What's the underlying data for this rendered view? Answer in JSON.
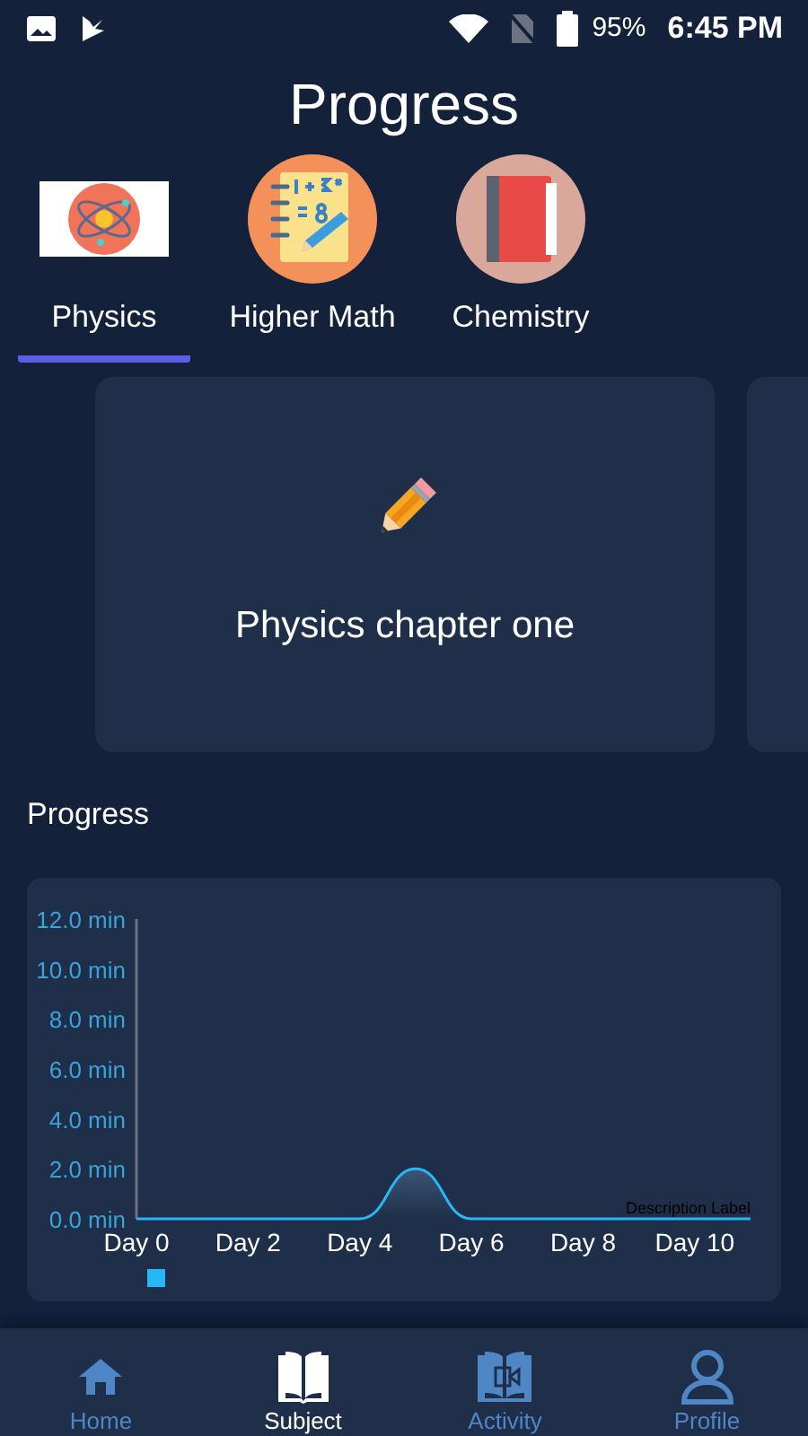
{
  "status_bar": {
    "battery": "95%",
    "time": "6:45 PM"
  },
  "title": "Progress",
  "tabs": [
    {
      "label": "Physics",
      "selected": true,
      "kind": "atom"
    },
    {
      "label": "Higher Math",
      "selected": false,
      "kind": "notebook"
    },
    {
      "label": "Chemistry",
      "selected": false,
      "kind": "book"
    }
  ],
  "cards": [
    {
      "title": "Physics chapter one"
    }
  ],
  "section_label": "Progress",
  "chart_data": {
    "type": "line",
    "categories": [
      "Day 0",
      null,
      "Day 2",
      null,
      "Day 4",
      null,
      "Day 6",
      null,
      "Day 8",
      null,
      "Day 10",
      null
    ],
    "series": [
      {
        "color": "#29b6f6",
        "values": [
          0,
          0,
          0,
          0,
          0,
          2,
          0,
          0,
          0,
          0,
          0,
          0
        ]
      }
    ],
    "ylim": [
      0,
      12
    ],
    "yticks": [
      {
        "value": 0,
        "label": "0.0 min"
      },
      {
        "value": 2,
        "label": "2.0 min"
      },
      {
        "value": 4,
        "label": "4.0 min"
      },
      {
        "value": 6,
        "label": "6.0 min"
      },
      {
        "value": 8,
        "label": "8.0 min"
      },
      {
        "value": 10,
        "label": "10.0 min"
      },
      {
        "value": 12,
        "label": "12.0 min"
      }
    ],
    "annotations": [
      {
        "text": "Description Label"
      }
    ]
  },
  "nav": [
    {
      "label": "Home",
      "selected": false,
      "kind": "home"
    },
    {
      "label": "Subject",
      "selected": true,
      "kind": "book"
    },
    {
      "label": "Activity",
      "selected": false,
      "kind": "video"
    },
    {
      "label": "Profile",
      "selected": false,
      "kind": "person"
    }
  ]
}
